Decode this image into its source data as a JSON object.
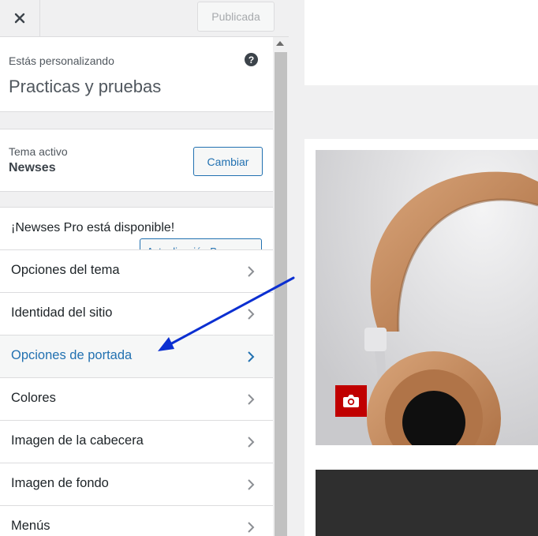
{
  "header": {
    "close_icon": "close-icon",
    "publish_label": "Publicada"
  },
  "info": {
    "label": "Estás personalizando",
    "title": "Practicas y pruebas",
    "help_icon": "?"
  },
  "theme": {
    "label": "Tema activo",
    "name": "Newses",
    "change_label": "Cambiar"
  },
  "promo": {
    "text": "¡Newses Pro está disponible!",
    "button_label": "Actualización Pro"
  },
  "menu": {
    "items": [
      {
        "label": "Opciones del tema"
      },
      {
        "label": "Identidad del sitio"
      },
      {
        "label": "Opciones de portada",
        "active": true
      },
      {
        "label": "Colores"
      },
      {
        "label": "Imagen de la cabecera"
      },
      {
        "label": "Imagen de fondo"
      },
      {
        "label": "Menús"
      }
    ]
  },
  "preview": {
    "image_subject": "headphones",
    "camera_icon": "camera-icon"
  },
  "colors": {
    "accent": "#2271b1",
    "annotation_arrow": "#0b2fd1",
    "camera_button": "#c00000"
  }
}
